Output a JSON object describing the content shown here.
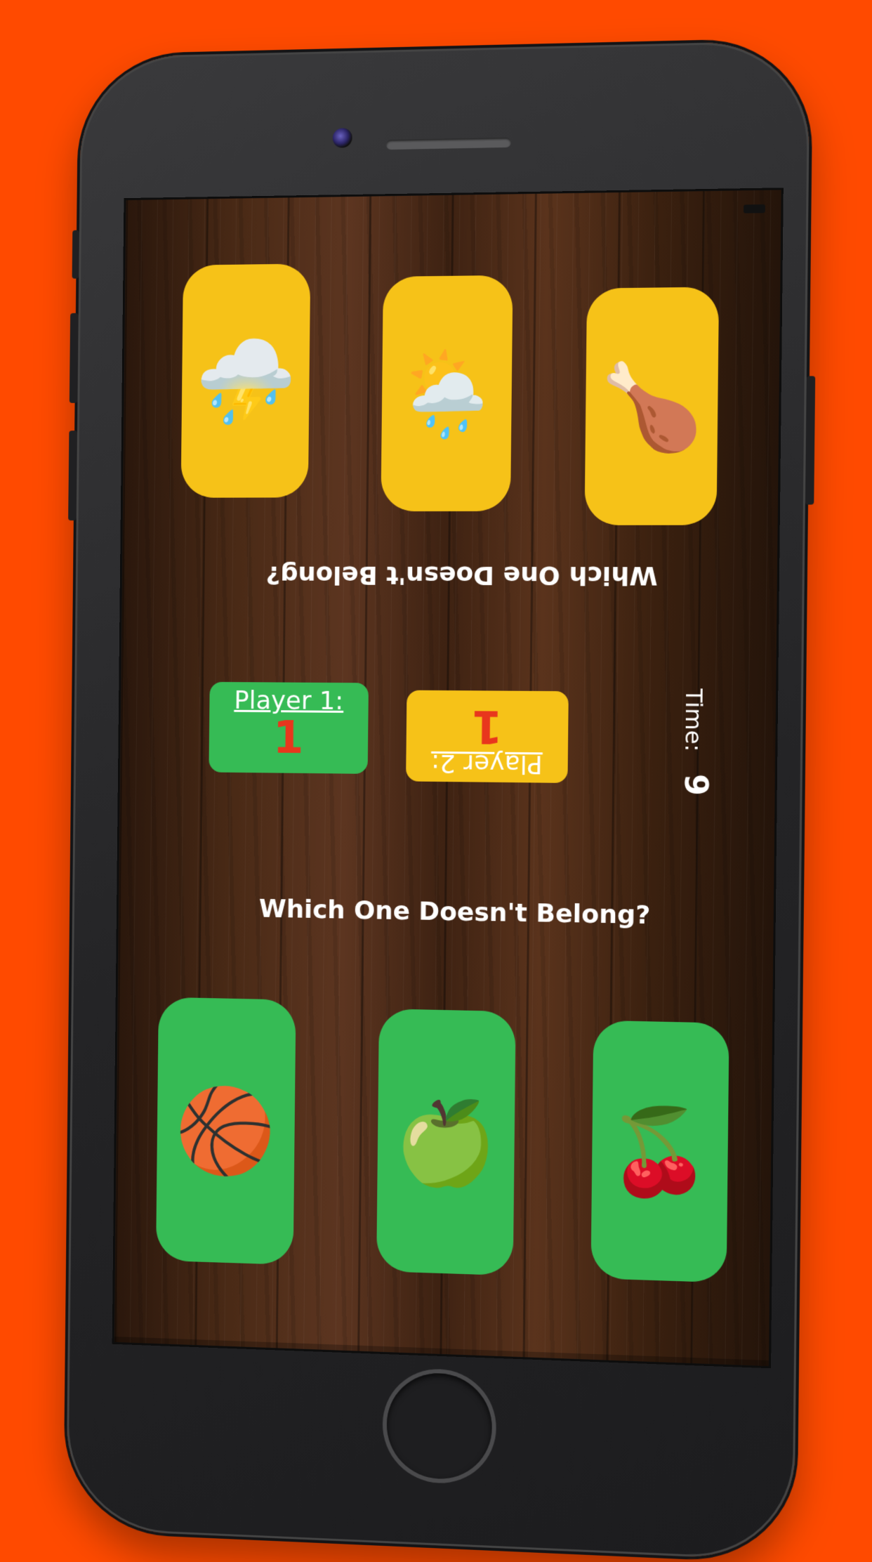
{
  "background_color": "#ff4a00",
  "screen": {
    "top_prompt": "Which One Doesn't Belong?",
    "bottom_prompt": "Which One Doesn't Belong?",
    "top_cards": [
      {
        "icon": "cloud-rain-lightning-icon",
        "glyph": "⛈️"
      },
      {
        "icon": "sun-behind-rain-cloud-icon",
        "glyph": "🌦️"
      },
      {
        "icon": "poultry-leg-icon",
        "glyph": "🍗"
      }
    ],
    "bottom_cards": [
      {
        "icon": "basketball-icon",
        "glyph": "🏀"
      },
      {
        "icon": "green-apple-icon",
        "glyph": "🍏"
      },
      {
        "icon": "cherries-icon",
        "glyph": "🍒"
      }
    ],
    "player1": {
      "label": "Player 1:",
      "score": "1"
    },
    "player2": {
      "label": "Player 2:",
      "score": "1"
    },
    "timer": {
      "label": "Time:",
      "value": "9"
    }
  },
  "colors": {
    "card_yellow": "#f6c218",
    "card_green": "#36bb55",
    "score_red": "#e8361d"
  }
}
